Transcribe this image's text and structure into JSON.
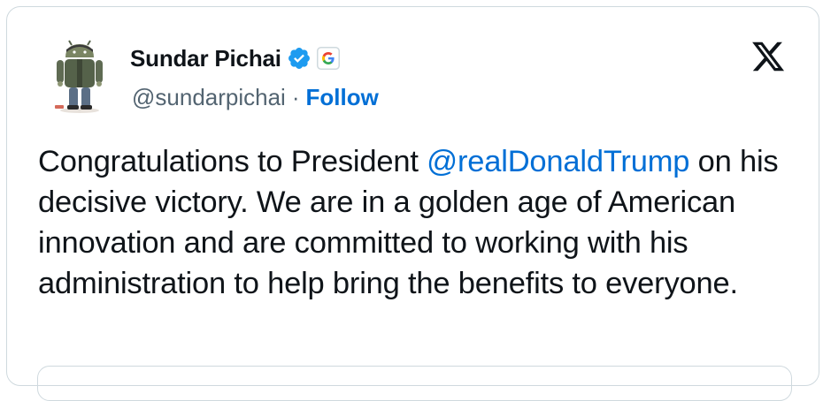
{
  "author": {
    "name": "Sundar Pichai",
    "handle": "@sundarpichai",
    "separator": "·",
    "follow_label": "Follow",
    "verified_icon": "verified-badge-icon",
    "affiliate_icon": "google-g-logo-icon",
    "avatar_icon": "android-figure-avatar"
  },
  "brand": {
    "logo_icon": "x-logo-icon"
  },
  "tweet": {
    "text_before": "Congratulations to President ",
    "mention": "@realDonaldTrump",
    "text_after": " on his decisive victory. We are in a golden age of American innovation and are committed to working with his administration to help bring the benefits to everyone."
  },
  "colors": {
    "link": "#006fd6",
    "verified": "#1d9bf0",
    "text": "#0f1419",
    "secondary": "#536471",
    "border": "#cfd9de"
  }
}
